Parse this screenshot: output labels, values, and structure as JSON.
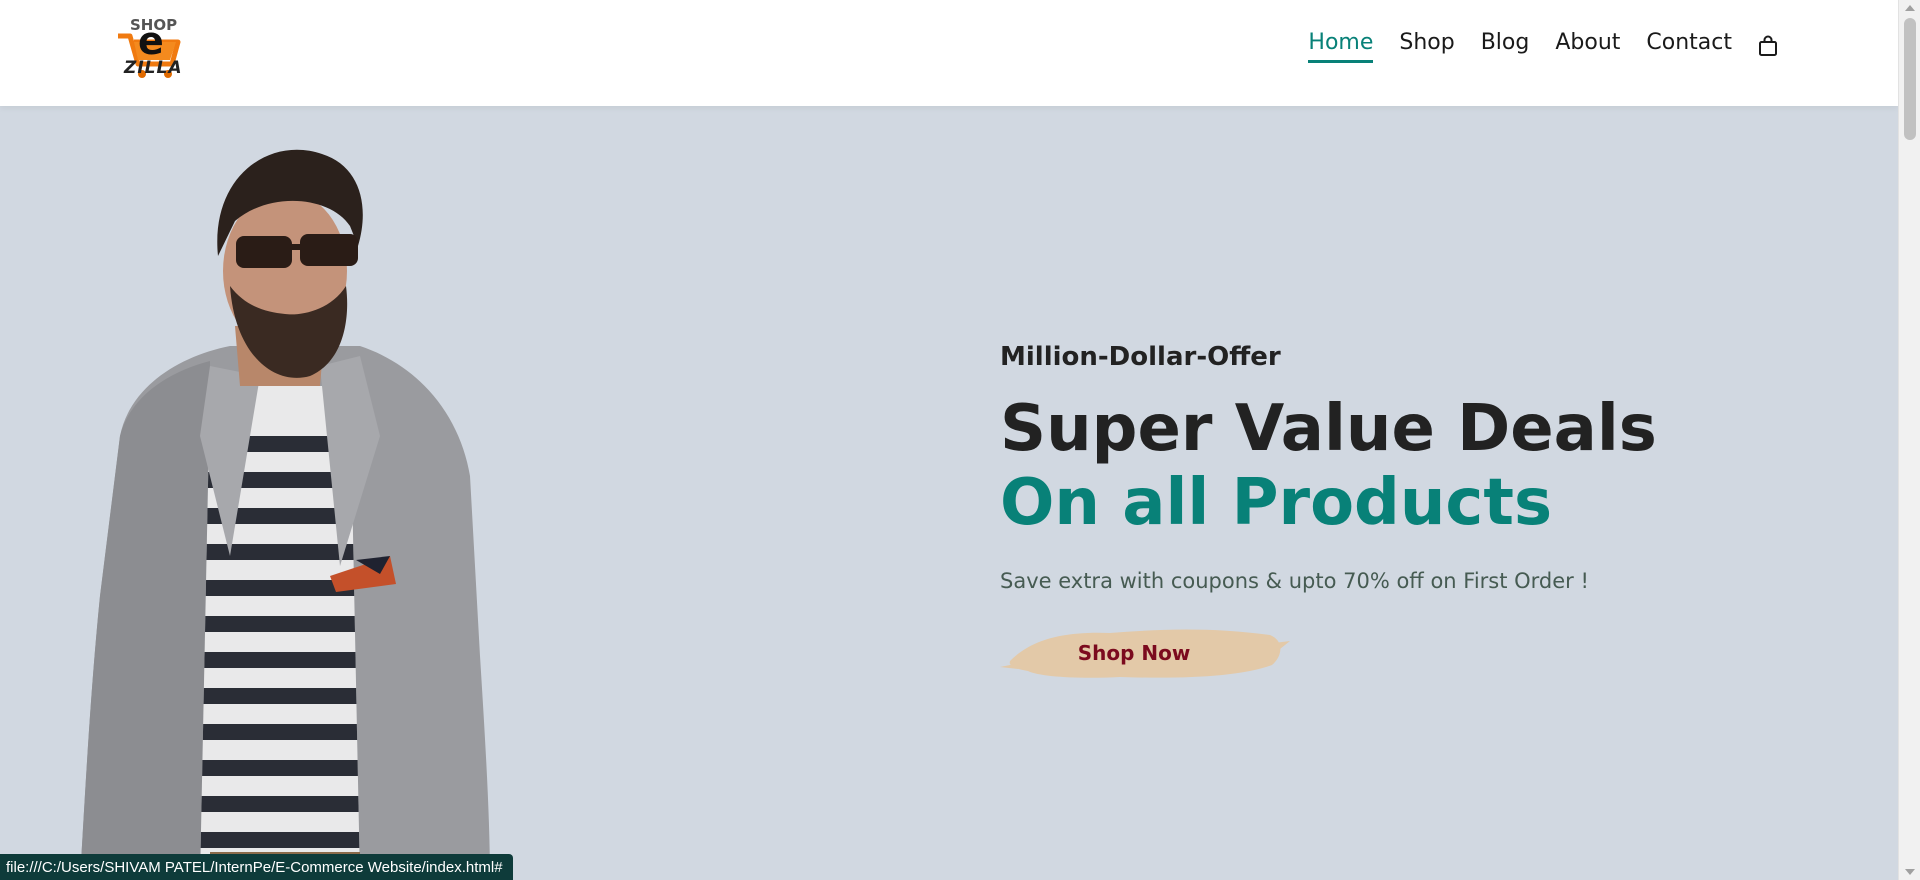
{
  "header": {
    "logo": {
      "top_text": "SHOP",
      "letter": "e",
      "bottom_text": "ZILLA"
    },
    "nav": [
      {
        "label": "Home",
        "active": true
      },
      {
        "label": "Shop",
        "active": false
      },
      {
        "label": "Blog",
        "active": false
      },
      {
        "label": "About",
        "active": false
      },
      {
        "label": "Contact",
        "active": false
      }
    ],
    "cart_icon": "shopping-bag-icon"
  },
  "hero": {
    "offer": "Million-Dollar-Offer",
    "headline": "Super Value Deals",
    "headline_accent": "On all Products",
    "subtext": "Save extra with coupons & upto 70% off on First Order !",
    "cta_label": "Shop Now"
  },
  "status_bar": {
    "url": "file:///C:/Users/SHIVAM PATEL/InternPe/E-Commerce Website/index.html#"
  },
  "colors": {
    "accent": "#088178",
    "hero_bg": "#d1d8e1",
    "cta_bg": "#e3c9a8",
    "cta_text": "#7b0a1e",
    "text_dark": "#222222"
  }
}
